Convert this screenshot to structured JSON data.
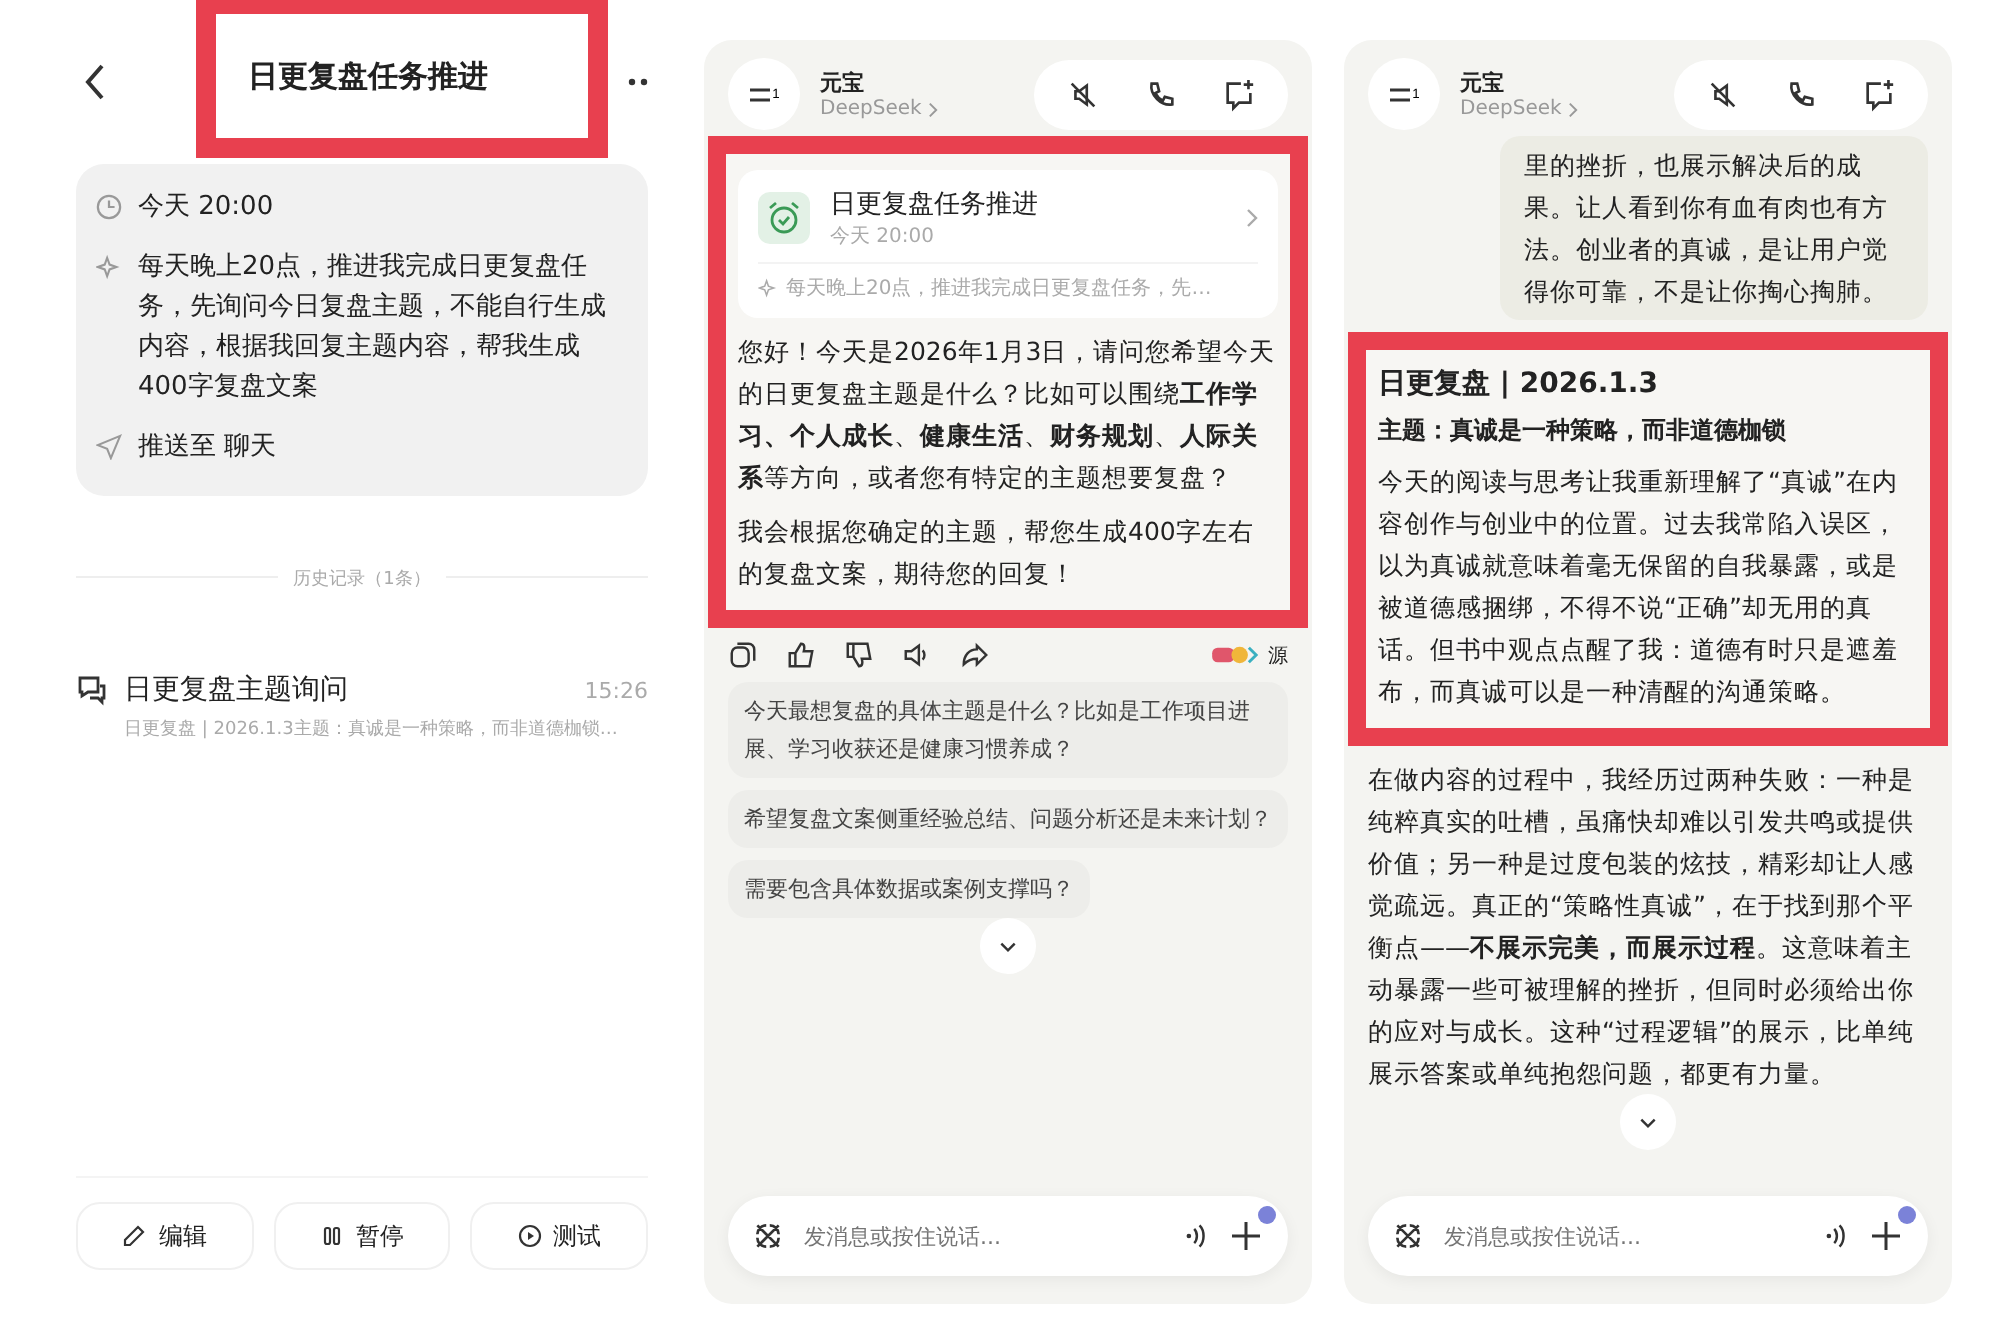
{
  "task_panel": {
    "title": "日更复盘任务推进",
    "title_highlighted": true,
    "schedule": "今天  20:00",
    "prompt": "每天晚上20点，推进我完成日更复盘任务，先询问今日复盘主题，不能自行生成内容，根据我回复主题内容，帮我生成400字复盘文案",
    "push_target": "推送至 聊天",
    "history_label": "历史记录（1条）",
    "history": [
      {
        "title": "日更复盘主题询问",
        "time": "15:26",
        "preview": "日更复盘 | 2026.1.3主题：真诚是一种策略，而非道德枷锁…"
      }
    ],
    "actions": [
      {
        "kind": "edit",
        "label": "编辑"
      },
      {
        "kind": "pause",
        "label": "暂停"
      },
      {
        "kind": "test",
        "label": "测试"
      }
    ]
  },
  "chat_panels": [
    {
      "menu_badge": "1",
      "name": "元宝",
      "model": "DeepSeek",
      "placeholder": "发消息或按住说话...",
      "sections": [
        {
          "highlighted": true,
          "items": [
            {
              "kind": "task_card",
              "title": "日更复盘任务推进",
              "time": "今天  20:00",
              "summary": "每天晚上20点，推进我完成日更复盘任务，先…"
            },
            {
              "kind": "text",
              "text": "您好！今天是2026年1月3日，请问您希望今天的日更复盘主题是什么？比如可以围绕**工作学习、个人成长**、**健康生活**、**财务规划**、**人际关系**等方向，或者您有特定的主题想要复盘？"
            },
            {
              "kind": "text",
              "text": "我会根据您确定的主题，帮您生成400字左右的复盘文案，期待您的回复！"
            }
          ]
        },
        {
          "highlighted": false,
          "items": [
            {
              "kind": "actions",
              "source": "源"
            },
            {
              "kind": "suggestion",
              "text": "今天最想复盘的具体主题是什么？比如是工作项目进展、学习收获还是健康习惯养成？"
            },
            {
              "kind": "suggestion",
              "text": "希望复盘文案侧重经验总结、问题分析还是未来计划？"
            },
            {
              "kind": "suggestion",
              "text": "需要包含具体数据或案例支撑吗？"
            }
          ]
        }
      ]
    },
    {
      "menu_badge": "1",
      "name": "元宝",
      "model": "DeepSeek",
      "placeholder": "发消息或按住说话...",
      "sections": [
        {
          "highlighted": false,
          "items": [
            {
              "kind": "user_bubble",
              "text": "里的挫折，也展示解决后的成果。让人看到你有血有肉也有方法。创业者的真诚，是让用户觉得你可靠，不是让你掏心掏肺。"
            }
          ]
        },
        {
          "highlighted": true,
          "items": [
            {
              "kind": "heading",
              "text": "日更复盘 | 2026.1.3"
            },
            {
              "kind": "topic",
              "text": "主题：真诚是一种策略，而非道德枷锁"
            },
            {
              "kind": "text",
              "text": "今天的阅读与思考让我重新理解了“真诚”在内容创作与创业中的位置。过去我常陷入误区，以为真诚就意味着毫无保留的自我暴露，或是被道德感捆绑，不得不说“正确”却无用的真话。但书中观点点醒了我：道德有时只是遮羞布，而真诚可以是一种清醒的沟通策略。"
            }
          ]
        },
        {
          "highlighted": false,
          "items": [
            {
              "kind": "text",
              "text": "在做内容的过程中，我经历过两种失败：一种是纯粹真实的吐槽，虽痛快却难以引发共鸣或提供价值；另一种是过度包装的炫技，精彩却让人感觉疏远。真正的“策略性真诚”，在于找到那个平衡点——**不展示完美，而展示过程**。这意味着主动暴露一些可被理解的挫折，但同时必须给出你的应对与成长。这种“过程逻辑”的展示，比单纯展示答案或单纯抱怨问题，都更有力量。"
            }
          ]
        }
      ]
    }
  ]
}
